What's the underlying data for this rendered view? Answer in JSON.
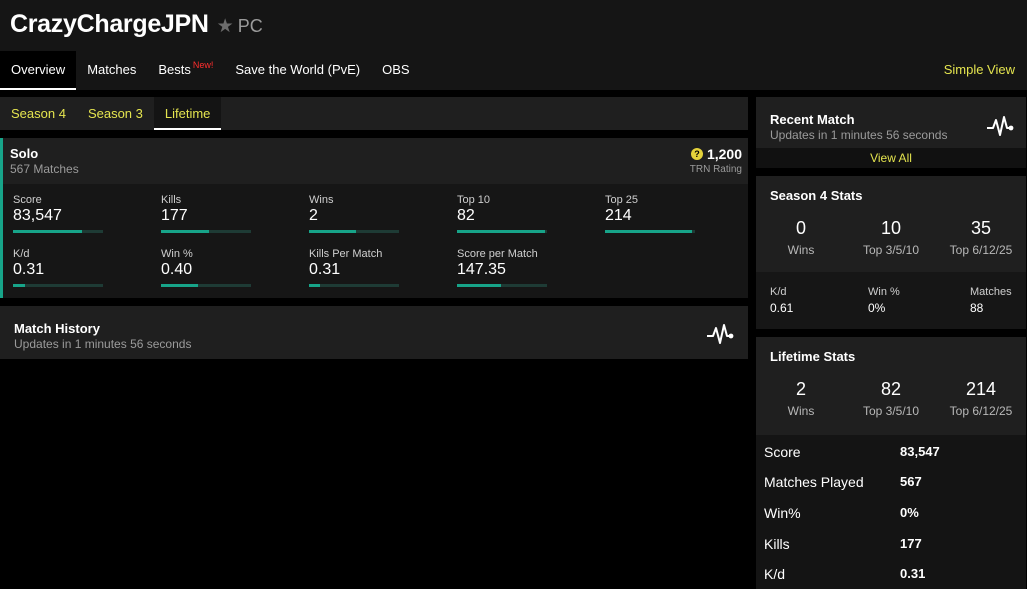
{
  "profile": {
    "name": "CrazyChargeJPN",
    "platform": "PC"
  },
  "nav": {
    "items": [
      {
        "label": "Overview"
      },
      {
        "label": "Matches"
      },
      {
        "label": "Bests",
        "badge": "New!"
      },
      {
        "label": "Save the World (PvE)"
      },
      {
        "label": "OBS"
      }
    ],
    "simple_view": "Simple View"
  },
  "season_tabs": [
    {
      "label": "Season 4"
    },
    {
      "label": "Season 3"
    },
    {
      "label": "Lifetime"
    }
  ],
  "solo": {
    "title": "Solo",
    "matches": "567 Matches",
    "trn_value": "1,200",
    "trn_label": "TRN Rating",
    "trn_icon": "?",
    "stats": [
      {
        "label": "Score",
        "value": "83,547",
        "bar": 0.77
      },
      {
        "label": "Kills",
        "value": "177",
        "bar": 0.53
      },
      {
        "label": "Wins",
        "value": "2",
        "bar": 0.52
      },
      {
        "label": "Top 10",
        "value": "82",
        "bar": 0.98
      },
      {
        "label": "Top 25",
        "value": "214",
        "bar": 0.97
      },
      {
        "label": "K/d",
        "value": "0.31",
        "bar": 0.13
      },
      {
        "label": "Win %",
        "value": "0.40",
        "bar": 0.41
      },
      {
        "label": "Kills Per Match",
        "value": "0.31",
        "bar": 0.12
      },
      {
        "label": "Score per Match",
        "value": "147.35",
        "bar": 0.49
      }
    ]
  },
  "match_history": {
    "title": "Match History",
    "subtitle": "Updates in 1 minutes 56 seconds"
  },
  "recent_match": {
    "title": "Recent Match",
    "subtitle": "Updates in 1 minutes 56 seconds",
    "view_all": "View All"
  },
  "season4_stats": {
    "title": "Season 4 Stats",
    "big": [
      {
        "value": "0",
        "label": "Wins"
      },
      {
        "value": "10",
        "label": "Top 3/5/10"
      },
      {
        "value": "35",
        "label": "Top 6/12/25"
      }
    ],
    "small": [
      {
        "label": "K/d",
        "value": "0.61"
      },
      {
        "label": "Win %",
        "value": "0%"
      },
      {
        "label": "Matches",
        "value": "88"
      }
    ]
  },
  "lifetime_stats": {
    "title": "Lifetime Stats",
    "big": [
      {
        "value": "2",
        "label": "Wins"
      },
      {
        "value": "82",
        "label": "Top 3/5/10"
      },
      {
        "value": "214",
        "label": "Top 6/12/25"
      }
    ],
    "rows": [
      {
        "label": "Score",
        "value": "83,547"
      },
      {
        "label": "Matches Played",
        "value": "567"
      },
      {
        "label": "Win%",
        "value": "0%"
      },
      {
        "label": "Kills",
        "value": "177"
      },
      {
        "label": "K/d",
        "value": "0.31"
      }
    ]
  },
  "colors": {
    "accent_yellow": "#e4e44f",
    "accent_teal": "#17a489",
    "badge_red": "#ff2e2e"
  },
  "icons": {
    "favorite": "star-icon",
    "activity": "pulse-icon",
    "rating": "trn-rating-icon"
  }
}
